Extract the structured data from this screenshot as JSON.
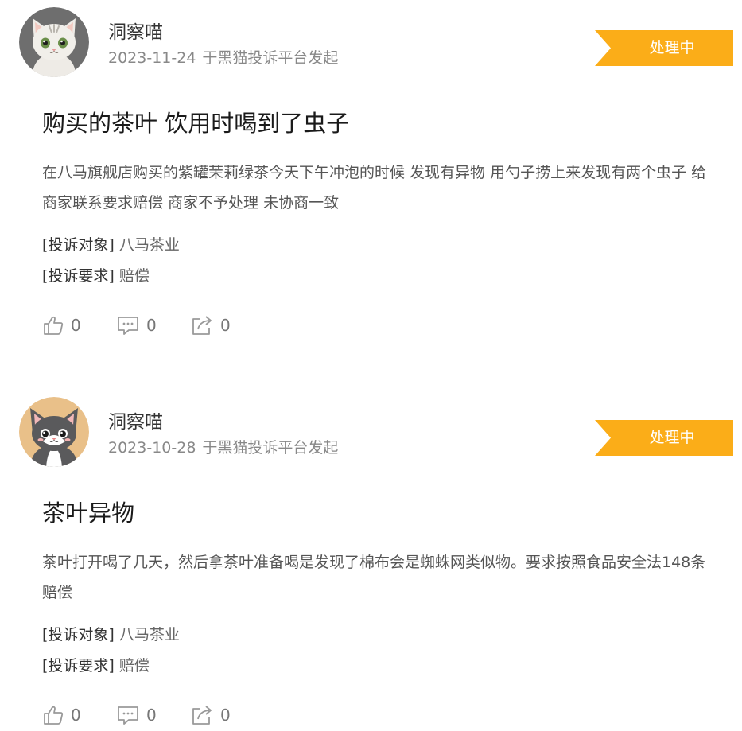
{
  "colors": {
    "status_badge": "#fbad18",
    "title": "#1a1a1a",
    "meta": "#888888",
    "body": "#555555",
    "divider": "#eeeeee"
  },
  "posts": [
    {
      "avatar": {
        "icon": "white-cat-avatar-icon",
        "bg": "#6e6e6e"
      },
      "user_name": "洞察喵",
      "date": "2023-11-24",
      "source": "于黑猫投诉平台发起",
      "status": "处理中",
      "title": "购买的茶叶 饮用时喝到了虫子",
      "body": "在八马旗舰店购买的紫罐茉莉绿茶今天下午冲泡的时候 发现有异物 用勺子捞上来发现有两个虫子 给商家联系要求赔偿 商家不予处理 未协商一致",
      "target_label": "[投诉对象]",
      "target_value": "八马茶业",
      "demand_label": "[投诉要求]",
      "demand_value": "赔偿",
      "likes": "0",
      "comments": "0",
      "shares": "0"
    },
    {
      "avatar": {
        "icon": "gray-cat-avatar-icon",
        "bg": "#e9c089"
      },
      "user_name": "洞察喵",
      "date": "2023-10-28",
      "source": "于黑猫投诉平台发起",
      "status": "处理中",
      "title": "茶叶异物",
      "body": "茶叶打开喝了几天，然后拿茶叶准备喝是发现了棉布会是蜘蛛网类似物。要求按照食品安全法148条赔偿",
      "target_label": "[投诉对象]",
      "target_value": "八马茶业",
      "demand_label": "[投诉要求]",
      "demand_value": "赔偿",
      "likes": "0",
      "comments": "0",
      "shares": "0"
    }
  ]
}
